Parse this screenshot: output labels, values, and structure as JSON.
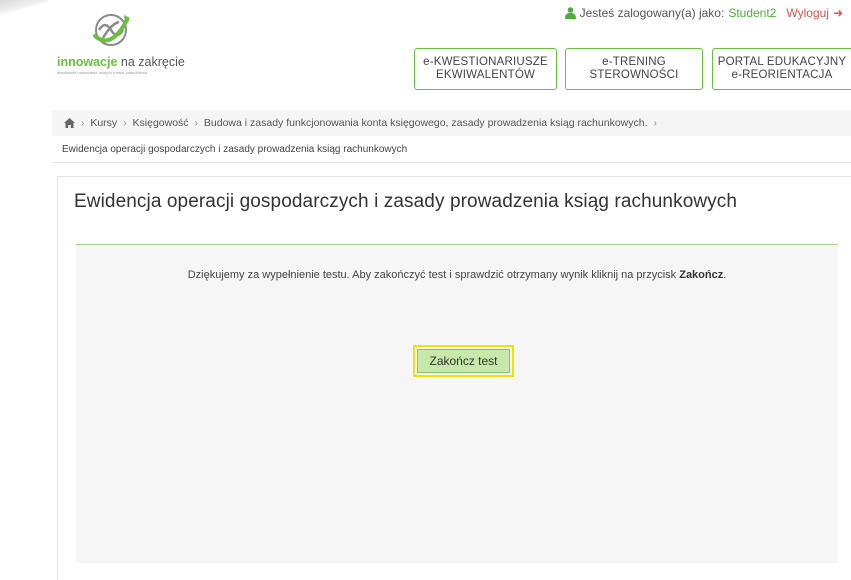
{
  "userbar": {
    "logged_as": "Jesteś zalogowany(a) jako:",
    "username": "Student2",
    "logout": "Wyloguj",
    "user_icon": "user-icon",
    "logout_icon": "sign-out-icon"
  },
  "logo": {
    "brand_bold": "innowacje",
    "brand_rest": " na zakręcie",
    "tagline": "testowanie i wdrażanie nowych metod zatrudnienia"
  },
  "nav": [
    {
      "line1": "e-KWESTIONARIUSZE",
      "line2": "EKWIWALENTÓW"
    },
    {
      "line1": "e-TRENING",
      "line2": "STEROWNOŚCI"
    },
    {
      "line1": "PORTAL EDUKACYJNY",
      "line2": "e-REORIENTACJA"
    }
  ],
  "breadcrumb": {
    "home_icon": "home-icon",
    "items": [
      "Kursy",
      "Księgowość",
      "Budowa i zasady funkcjonowania konta księgowego, zasady prowadzenia ksiąg rachunkowych."
    ],
    "sep": "›",
    "current": "Ewidencja operacji gospodarczych i zasady prowadzenia ksiąg rachunkowych"
  },
  "main": {
    "title": "Ewidencja operacji gospodarczych i zasady prowadzenia ksiąg rachunkowych",
    "message_text": "Dziękujemy za wypełnienie testu. Aby zakończyć test i sprawdzić otrzymany wynik kliknij na przycisk ",
    "message_bold": "Zakończ",
    "message_end": ".",
    "finish_button": "Zakończ test"
  },
  "colors": {
    "accent_green": "#6abf3e",
    "logout_red": "#d9534f",
    "highlight_yellow": "#f2e200",
    "button_green": "#c6e8a8"
  }
}
